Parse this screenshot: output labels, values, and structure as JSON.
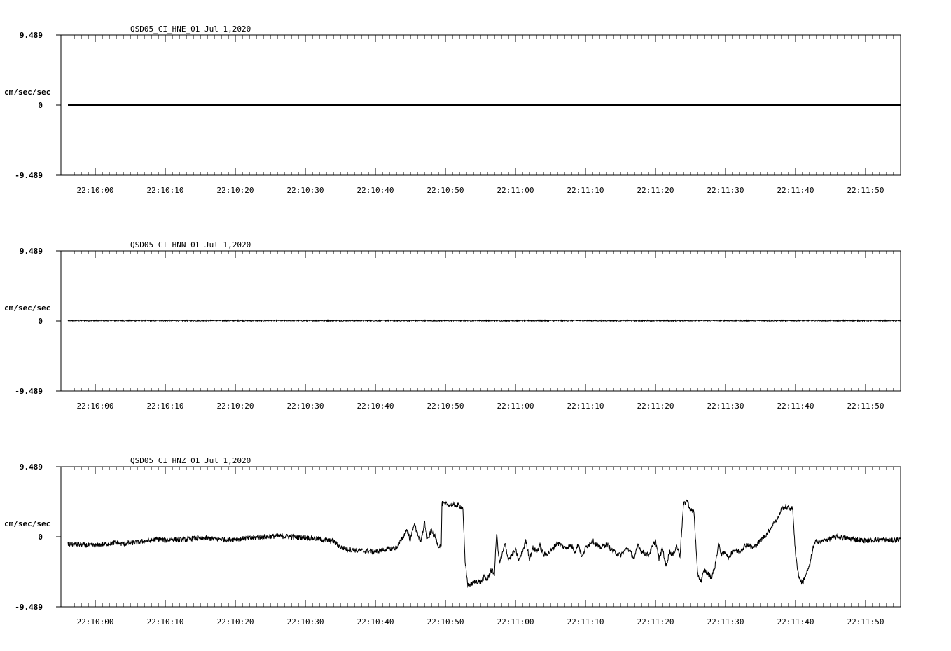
{
  "chart_data": [
    {
      "type": "line",
      "title": "QSD05_CI_HNE_01  Jul 1,2020",
      "ylabel": "cm/sec/sec",
      "ytick_labels": [
        "9.489",
        "0",
        "-9.489"
      ],
      "ylim": [
        -9.489,
        9.489
      ],
      "x_tick_labels": [
        "22:10:00",
        "22:10:10",
        "22:10:20",
        "22:10:30",
        "22:10:40",
        "22:10:50",
        "22:11:00",
        "22:11:10",
        "22:11:20",
        "22:11:30",
        "22:11:40",
        "22:11:50"
      ],
      "x_start_offset_s": -3.9,
      "x_end_offset_s": 115,
      "series": [
        {
          "style": "flat",
          "points": [
            [
              -3.9,
              0.0
            ],
            [
              115,
              0.0
            ]
          ]
        }
      ]
    },
    {
      "type": "line",
      "title": "QSD05_CI_HNN_01  Jul 1,2020",
      "ylabel": "cm/sec/sec",
      "ytick_labels": [
        "9.489",
        "0",
        "-9.489"
      ],
      "ylim": [
        -9.489,
        9.489
      ],
      "x_tick_labels": [
        "22:10:00",
        "22:10:10",
        "22:10:20",
        "22:10:30",
        "22:10:40",
        "22:10:50",
        "22:11:00",
        "22:11:10",
        "22:11:20",
        "22:11:30",
        "22:11:40",
        "22:11:50"
      ],
      "x_start_offset_s": -3.9,
      "x_end_offset_s": 115,
      "series": [
        {
          "style": "noise",
          "amplitude": 0.08,
          "points": [
            [
              -3.9,
              0.05
            ],
            [
              115,
              0.05
            ]
          ]
        }
      ]
    },
    {
      "type": "line",
      "title": "QSD05_CI_HNZ_01  Jul 1,2020",
      "ylabel": "cm/sec/sec",
      "ytick_labels": [
        "9.489",
        "0",
        "-9.489"
      ],
      "ylim": [
        -9.489,
        9.489
      ],
      "x_tick_labels": [
        "22:10:00",
        "22:10:10",
        "22:10:20",
        "22:10:30",
        "22:10:40",
        "22:10:50",
        "22:11:00",
        "22:11:10",
        "22:11:20",
        "22:11:30",
        "22:11:40",
        "22:11:50"
      ],
      "x_start_offset_s": -3.9,
      "x_end_offset_s": 115,
      "series": [
        {
          "style": "noise",
          "amplitude": 0.35,
          "points": [
            [
              -3.9,
              -1.0
            ],
            [
              -2,
              -1.1
            ],
            [
              0,
              -1.2
            ],
            [
              2,
              -0.9
            ],
            [
              3,
              -0.8
            ],
            [
              4,
              -1.0
            ],
            [
              5,
              -0.8
            ],
            [
              6,
              -0.8
            ],
            [
              7,
              -0.6
            ],
            [
              8,
              -0.5
            ],
            [
              9,
              -0.3
            ],
            [
              10,
              -0.5
            ],
            [
              11,
              -0.3
            ],
            [
              12,
              -0.4
            ],
            [
              13,
              -0.4
            ],
            [
              14,
              -0.2
            ],
            [
              15,
              -0.3
            ],
            [
              16,
              -0.2
            ],
            [
              17,
              -0.3
            ],
            [
              18,
              -0.3
            ],
            [
              19,
              -0.4
            ],
            [
              20,
              -0.3
            ],
            [
              22,
              -0.2
            ],
            [
              24,
              0.0
            ],
            [
              26,
              0.1
            ],
            [
              28,
              0.0
            ],
            [
              30,
              -0.1
            ],
            [
              32,
              -0.3
            ],
            [
              33,
              -0.5
            ],
            [
              34,
              -0.6
            ],
            [
              35,
              -1.4
            ],
            [
              36,
              -1.7
            ],
            [
              38,
              -1.9
            ],
            [
              40,
              -2.0
            ],
            [
              42,
              -1.6
            ],
            [
              43,
              -1.5
            ],
            [
              44,
              0.0
            ],
            [
              44.5,
              1.0
            ],
            [
              45,
              -0.5
            ],
            [
              45.5,
              1.8
            ],
            [
              46,
              0.5
            ],
            [
              46.5,
              -0.8
            ],
            [
              47,
              2.0
            ],
            [
              47.5,
              -0.5
            ],
            [
              48,
              1.0
            ],
            [
              48.5,
              0.0
            ],
            [
              49,
              -1.2
            ],
            [
              49.4,
              -1.3
            ],
            [
              49.5,
              4.5
            ],
            [
              50,
              4.4
            ],
            [
              51.5,
              4.3
            ],
            [
              52,
              4.2
            ],
            [
              52.3,
              4.1
            ],
            [
              52.5,
              3.8
            ],
            [
              52.8,
              -3.5
            ],
            [
              53.2,
              -6.6
            ],
            [
              54.5,
              -6.0
            ],
            [
              55,
              -6.2
            ],
            [
              55.5,
              -5.5
            ],
            [
              56,
              -5.8
            ],
            [
              56.5,
              -4.5
            ],
            [
              57,
              -5.0
            ],
            [
              57.3,
              0.5
            ],
            [
              57.7,
              -3.5
            ],
            [
              58,
              -2.8
            ],
            [
              58.5,
              -1.0
            ],
            [
              59,
              -3.0
            ],
            [
              59.5,
              -2.5
            ],
            [
              60,
              -1.8
            ],
            [
              60.5,
              -3.2
            ],
            [
              61,
              -2.0
            ],
            [
              61.5,
              -0.5
            ],
            [
              62,
              -3.0
            ],
            [
              62.5,
              -1.5
            ],
            [
              63,
              -2.0
            ],
            [
              63.5,
              -1.2
            ],
            [
              64,
              -2.5
            ],
            [
              65,
              -2.0
            ],
            [
              66,
              -0.8
            ],
            [
              67,
              -1.5
            ],
            [
              68,
              -1.2
            ],
            [
              68.5,
              -2.0
            ],
            [
              69,
              -1.0
            ],
            [
              69.5,
              -2.8
            ],
            [
              70,
              -1.5
            ],
            [
              71,
              -0.5
            ],
            [
              72,
              -1.5
            ],
            [
              73,
              -1.0
            ],
            [
              74,
              -2.0
            ],
            [
              75,
              -2.5
            ],
            [
              76,
              -1.5
            ],
            [
              77,
              -3.0
            ],
            [
              77.5,
              -1.0
            ],
            [
              78,
              -2.0
            ],
            [
              79,
              -2.5
            ],
            [
              80,
              -0.5
            ],
            [
              80.5,
              -3.0
            ],
            [
              81,
              -1.5
            ],
            [
              81.5,
              -4.0
            ],
            [
              82,
              -2.0
            ],
            [
              82.5,
              -2.5
            ],
            [
              83,
              -1.2
            ],
            [
              83.5,
              -2.5
            ],
            [
              84,
              4.3
            ],
            [
              84.5,
              5.0
            ],
            [
              85,
              3.6
            ],
            [
              85.5,
              3.4
            ],
            [
              86,
              -5.0
            ],
            [
              86.5,
              -6.0
            ],
            [
              87,
              -4.5
            ],
            [
              88,
              -5.5
            ],
            [
              88.5,
              -4.0
            ],
            [
              89,
              -1.0
            ],
            [
              89.5,
              -2.5
            ],
            [
              90,
              -2.0
            ],
            [
              90.5,
              -3.0
            ],
            [
              91,
              -1.8
            ],
            [
              92,
              -2.0
            ],
            [
              93,
              -1.0
            ],
            [
              94,
              -1.5
            ],
            [
              95,
              -0.5
            ],
            [
              96,
              0.5
            ],
            [
              97,
              2.0
            ],
            [
              97.5,
              2.5
            ],
            [
              98,
              3.8
            ],
            [
              98.5,
              4.0
            ],
            [
              99,
              3.9
            ],
            [
              99.6,
              3.8
            ],
            [
              100,
              -2.5
            ],
            [
              100.5,
              -5.5
            ],
            [
              101,
              -6.3
            ],
            [
              101.5,
              -5.0
            ],
            [
              102,
              -4.0
            ],
            [
              102.5,
              -1.5
            ],
            [
              103,
              -0.5
            ],
            [
              103.5,
              -0.8
            ],
            [
              104,
              -0.5
            ],
            [
              106,
              0.0
            ],
            [
              108,
              -0.3
            ],
            [
              110,
              -0.5
            ],
            [
              112,
              -0.4
            ],
            [
              114,
              -0.5
            ],
            [
              115,
              -0.3
            ]
          ]
        }
      ]
    }
  ]
}
